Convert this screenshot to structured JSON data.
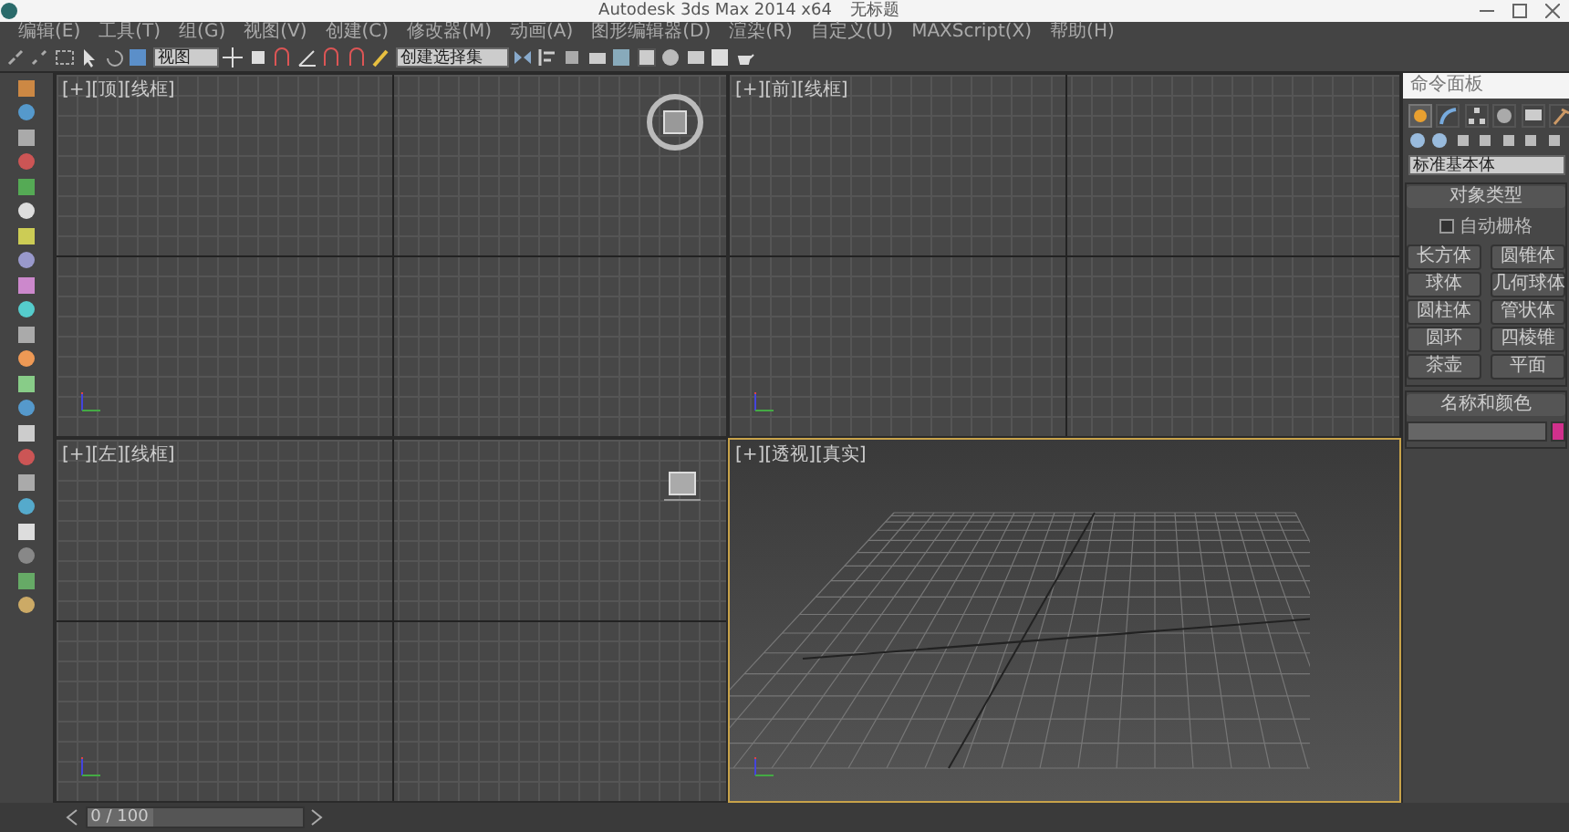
{
  "window": {
    "title": "Autodesk 3ds Max  2014 x64",
    "document": "无标题"
  },
  "menu": [
    "编辑(E)",
    "工具(T)",
    "组(G)",
    "视图(V)",
    "创建(C)",
    "修改器(M)",
    "动画(A)",
    "图形编辑器(D)",
    "渲染(R)",
    "自定义(U)",
    "MAXScript(X)",
    "帮助(H)"
  ],
  "toolbar": {
    "view_dropdown": "视图",
    "selection_set_dropdown": "创建选择集"
  },
  "viewports": [
    {
      "label": "[+][顶][线框]",
      "kind": "ortho",
      "active": false
    },
    {
      "label": "[+][前][线框]",
      "kind": "ortho",
      "active": false
    },
    {
      "label": "[+][左][线框]",
      "kind": "ortho",
      "active": false
    },
    {
      "label": "[+][透视][真实]",
      "kind": "perspective",
      "active": true
    }
  ],
  "command_panel": {
    "title": "命令面板",
    "tabs": [
      {
        "selected": true
      },
      {
        "selected": false
      },
      {
        "selected": false
      },
      {
        "selected": false
      },
      {
        "selected": false
      },
      {
        "selected": false
      }
    ],
    "category_dropdown": "标准基本体",
    "object_type": {
      "title": "对象类型",
      "autogrid": {
        "label": "自动栅格",
        "checked": false
      },
      "buttons": [
        "长方体",
        "圆锥体",
        "球体",
        "几何球体",
        "圆柱体",
        "管状体",
        "圆环",
        "四棱锥",
        "茶壶",
        "平面"
      ]
    },
    "name_and_color": {
      "title": "名称和颜色",
      "color": "#d0308c"
    }
  },
  "timeline": {
    "position": "0 / 100",
    "level": 0
  }
}
